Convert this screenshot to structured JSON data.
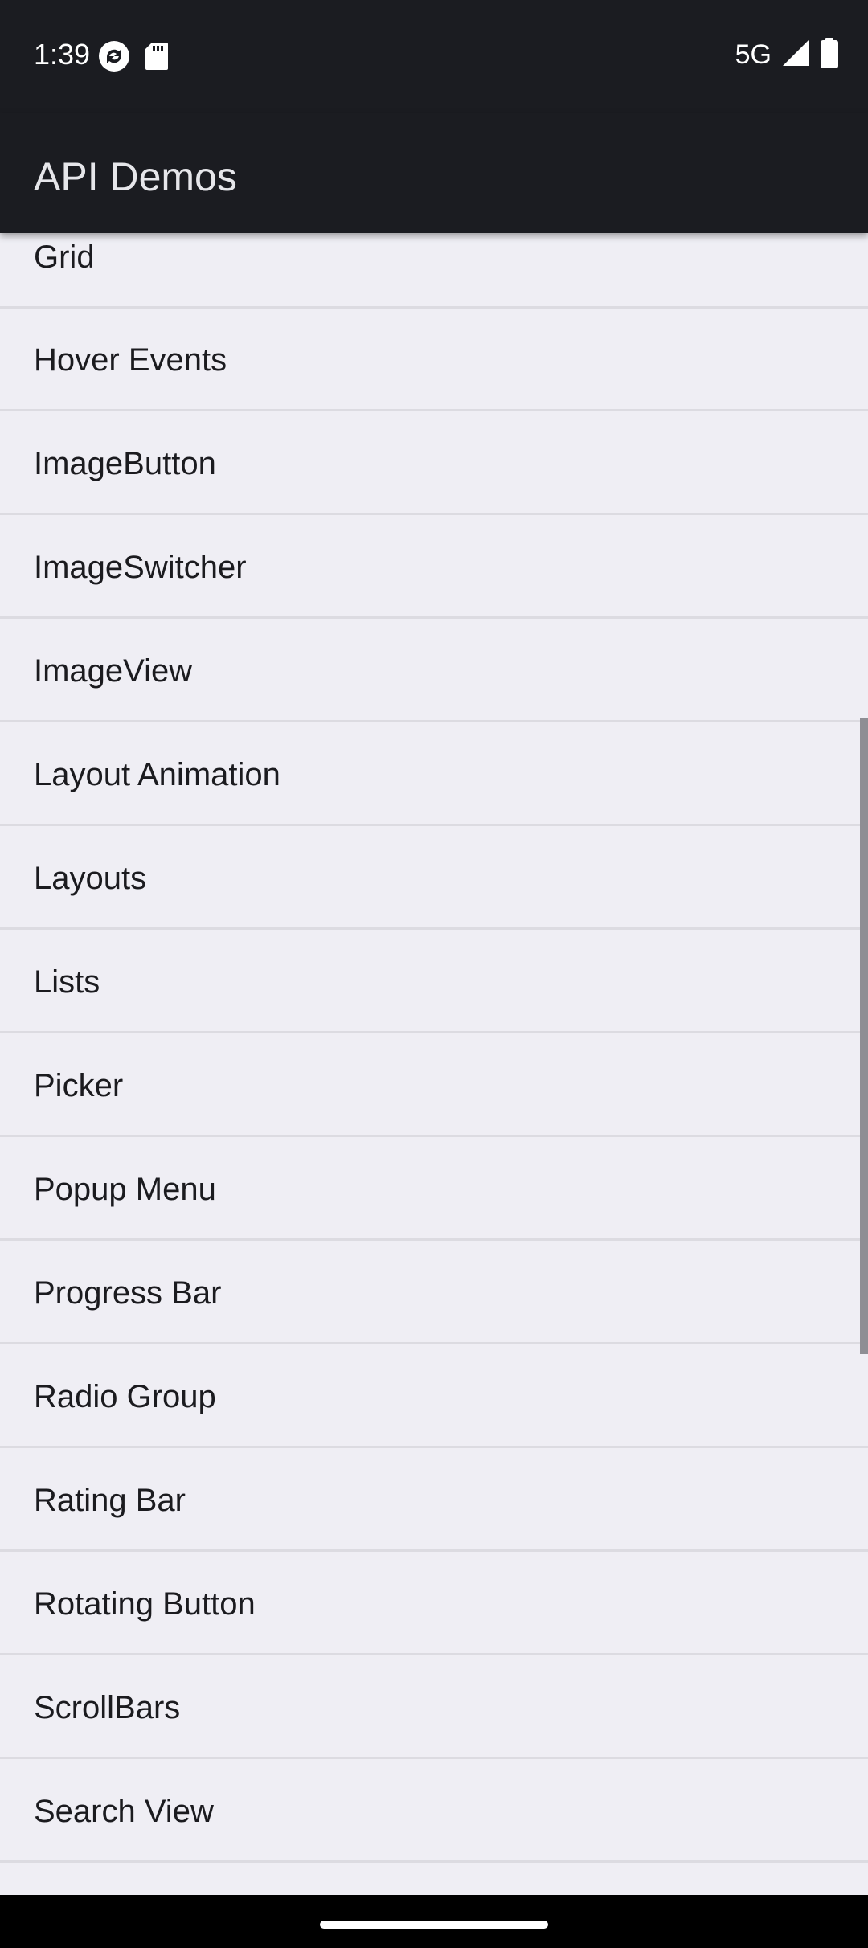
{
  "status_bar": {
    "time": "1:39",
    "network": "5G",
    "left_icons": [
      "sync-icon",
      "sd-card-icon"
    ],
    "right_icons": [
      "signal-icon",
      "battery-icon"
    ]
  },
  "app_bar": {
    "title": "API Demos"
  },
  "list": {
    "items": [
      {
        "label": "Grid"
      },
      {
        "label": "Hover Events"
      },
      {
        "label": "ImageButton"
      },
      {
        "label": "ImageSwitcher"
      },
      {
        "label": "ImageView"
      },
      {
        "label": "Layout Animation"
      },
      {
        "label": "Layouts"
      },
      {
        "label": "Lists"
      },
      {
        "label": "Picker"
      },
      {
        "label": "Popup Menu"
      },
      {
        "label": "Progress Bar"
      },
      {
        "label": "Radio Group"
      },
      {
        "label": "Rating Bar"
      },
      {
        "label": "Rotating Button"
      },
      {
        "label": "ScrollBars"
      },
      {
        "label": "Search View"
      },
      {
        "label": ""
      }
    ]
  },
  "colors": {
    "app_bar_bg": "#1b1c21",
    "list_bg": "#efeef4",
    "divider": "#dcdbe1",
    "text": "#1b1b1f"
  }
}
